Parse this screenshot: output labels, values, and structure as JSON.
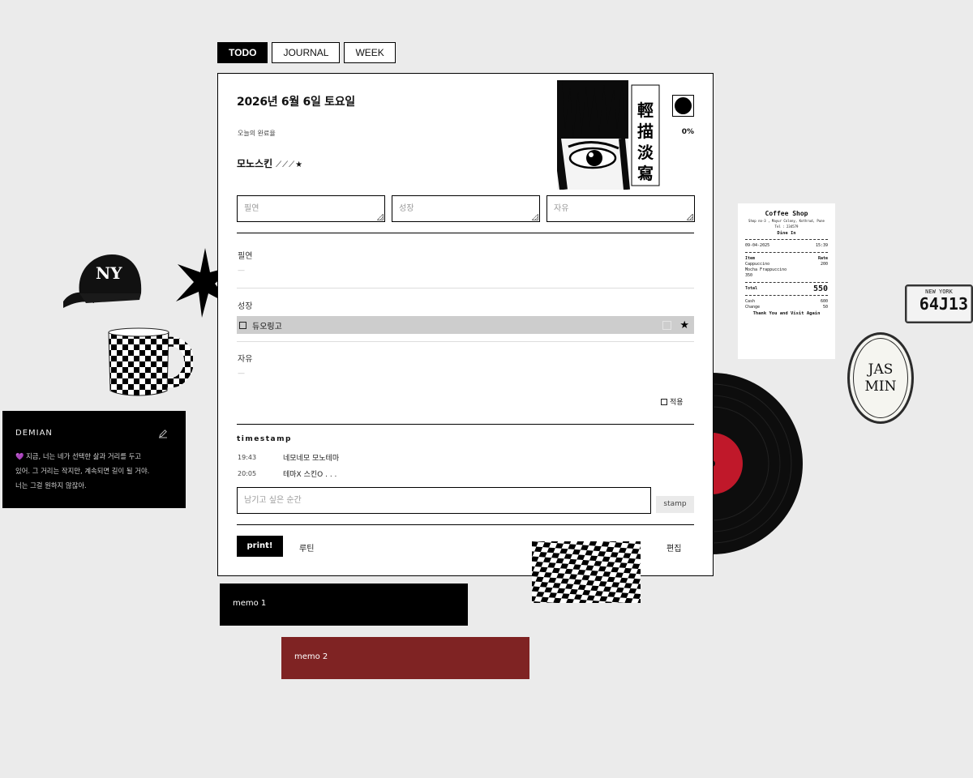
{
  "tabs": [
    {
      "label": "TODO",
      "active": true
    },
    {
      "label": "JOURNAL",
      "active": false
    },
    {
      "label": "WEEK",
      "active": false
    }
  ],
  "card": {
    "date_title": "2026년 6월 6일 토요일",
    "completion_label": "오늘의 완료율",
    "completion_percent": "0%",
    "category_title": "모노스킨",
    "category_marks": "⟋⟋⟋★",
    "manga_text": "輕描淡寫",
    "inputs": [
      {
        "placeholder": "필연",
        "value": ""
      },
      {
        "placeholder": "성장",
        "value": ""
      },
      {
        "placeholder": "자유",
        "value": ""
      }
    ],
    "sections": [
      {
        "label": "필연",
        "empty": "—"
      },
      {
        "label": "성장"
      },
      {
        "label": "자유",
        "empty": "—"
      }
    ],
    "tasks": [
      {
        "label": "듀오링고",
        "checked": false,
        "starred": true
      }
    ],
    "apply_label": "적용",
    "timestamp_title": "timestamp",
    "logs": [
      {
        "time": "19:43",
        "text": "네모네모 모노테마"
      },
      {
        "time": "20:05",
        "text": "테마X 스킨O . . ."
      }
    ],
    "moment_placeholder": "남기고 싶은 순간",
    "stamp_label": "stamp",
    "print_label": "print!",
    "routine_label": "루틴",
    "edit_label": "편집"
  },
  "memos": [
    {
      "label": "memo 1",
      "color": "#000000"
    },
    {
      "label": "memo 2",
      "color": "#7f2323"
    }
  ],
  "demian": {
    "title": "DEMIAN",
    "quote_lines": [
      "💜 지금, 너는 네가 선택한 삶과 거리를 두고",
      "있어. 그 거리는 작지만, 계속되면 길이 될 거야.",
      "너는 그걸 원하지 않잖아."
    ]
  },
  "receipt": {
    "title": "Coffee Shop",
    "address": "Shop no-3 , Mayur Colony, Kothrud, Pune",
    "phone": "Tel : 234579",
    "mode": "Dine In",
    "date": "09-04-2025",
    "time": "15:39",
    "col_item": "Item",
    "col_rate": "Rate",
    "items": [
      {
        "name": "Cappuccino",
        "rate": "200"
      },
      {
        "name": "Mocha Frappuccino",
        "rate": ""
      },
      {
        "name": "350",
        "rate": ""
      }
    ],
    "total_label": "Total",
    "total_value": "550",
    "cash_label": "Cash",
    "cash_value": "600",
    "change_label": "Change",
    "change_value": "50",
    "thanks": "Thank You and Visit Again"
  },
  "plate": {
    "top": "NEW YORK",
    "number": "64J13"
  },
  "candle": {
    "line1": "JAS",
    "line2": "MIN"
  },
  "colors": {
    "accent_red": "#7f2323",
    "record_label": "#c0182a",
    "background": "#ebebeb"
  }
}
